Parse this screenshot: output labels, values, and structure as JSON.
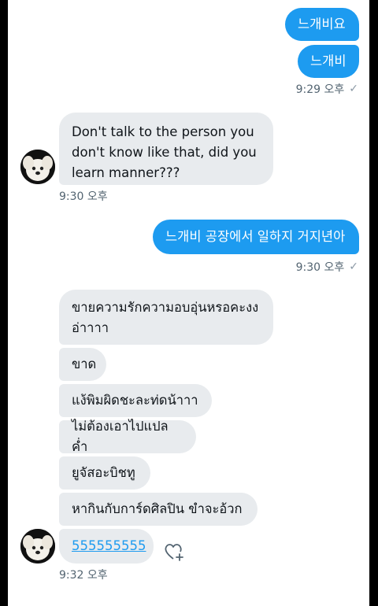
{
  "messages": [
    {
      "side": "out",
      "text": "느개비요"
    },
    {
      "side": "out",
      "text": "느개비"
    },
    {
      "side": "in",
      "text": "Don't talk to the person you don't know like that, did you learn manner???"
    },
    {
      "side": "out",
      "text": "느개비 공장에서 일하지 거지년아"
    },
    {
      "side": "in",
      "text": "ขายความรักความอบอุ่นหรอคะงง อ่าาาา"
    },
    {
      "side": "in",
      "text": "ขาด"
    },
    {
      "side": "in",
      "text": "แง้พิมผิดชะละท่ดน้าาา"
    },
    {
      "side": "in",
      "text": "ไม่ต้องเอาไปแปลค่ำ"
    },
    {
      "side": "in",
      "text": "ยูจัสอะบิชทู"
    },
    {
      "side": "in",
      "text": "หากินกับการ์ดศิลปิน ขำจะอ้วก"
    },
    {
      "side": "in",
      "text": "555555555",
      "link": true
    }
  ],
  "timestamps": {
    "t1": "9:29 오후",
    "t2": "9:30 오후",
    "t3": "9:30 오후",
    "t4": "9:32 오후"
  },
  "icons": {
    "read_receipt": "check-icon",
    "reaction": "heart-plus-icon",
    "avatar": "dog-avatar"
  },
  "colors": {
    "outgoing_bubble": "#1d9bf0",
    "incoming_bubble": "#e8ebee",
    "meta_text": "#536471"
  }
}
